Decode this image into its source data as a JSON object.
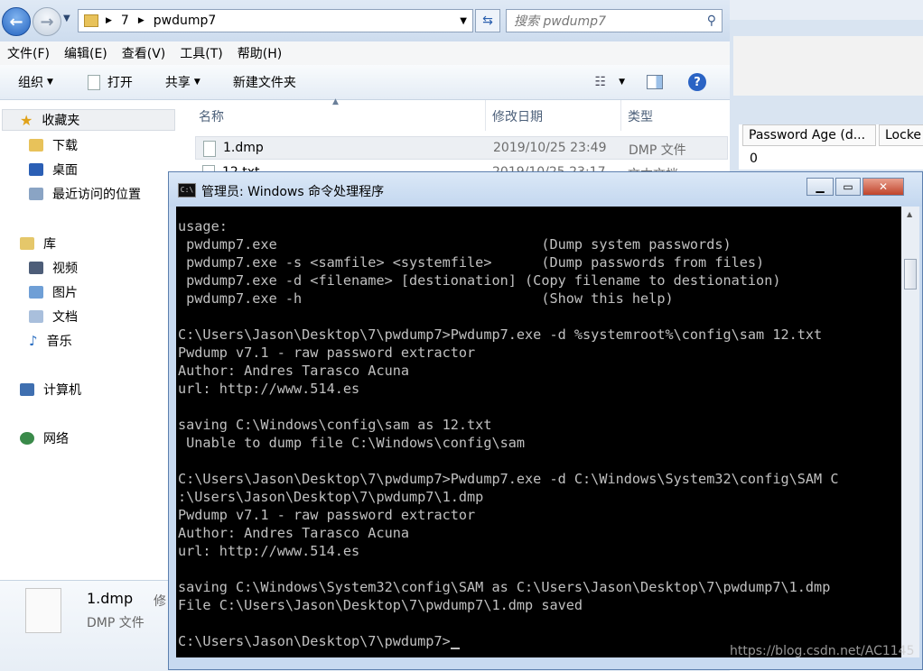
{
  "explorer": {
    "breadcrumb": [
      "7",
      "pwdump7"
    ],
    "search_placeholder": "搜索 pwdump7",
    "menu": [
      "文件(F)",
      "编辑(E)",
      "查看(V)",
      "工具(T)",
      "帮助(H)"
    ],
    "toolbar": {
      "organize": "组织",
      "open": "打开",
      "share": "共享",
      "new_folder": "新建文件夹"
    },
    "nav": {
      "favorites": "收藏夹",
      "downloads": "下载",
      "desktop": "桌面",
      "recent": "最近访问的位置",
      "libraries": "库",
      "videos": "视频",
      "pictures": "图片",
      "documents": "文档",
      "music": "音乐",
      "computer": "计算机",
      "network": "网络"
    },
    "columns": {
      "name": "名称",
      "modified": "修改日期",
      "type": "类型"
    },
    "files": [
      {
        "name": "1.dmp",
        "modified": "2019/10/25 23:49",
        "type": "DMP 文件"
      },
      {
        "name": "12.txt",
        "modified": "2019/10/25 23:17",
        "type": "文本文档"
      }
    ],
    "details": {
      "name": "1.dmp",
      "label_cut": "修",
      "type": "DMP 文件"
    }
  },
  "right_window": {
    "col_password_age": "Password Age (d...",
    "col_locked": "Locke",
    "value": "0"
  },
  "cmd": {
    "title": "管理员: Windows 命令处理程序",
    "lines": [
      "usage:",
      " pwdump7.exe                                (Dump system passwords)",
      " pwdump7.exe -s <samfile> <systemfile>      (Dump passwords from files)",
      " pwdump7.exe -d <filename> [destionation] (Copy filename to destionation)",
      " pwdump7.exe -h                             (Show this help)",
      "",
      "C:\\Users\\Jason\\Desktop\\7\\pwdump7>Pwdump7.exe -d %systemroot%\\config\\sam 12.txt",
      "Pwdump v7.1 - raw password extractor",
      "Author: Andres Tarasco Acuna",
      "url: http://www.514.es",
      "",
      "saving C:\\Windows\\config\\sam as 12.txt",
      " Unable to dump file C:\\Windows\\config\\sam",
      "",
      "C:\\Users\\Jason\\Desktop\\7\\pwdump7>Pwdump7.exe -d C:\\Windows\\System32\\config\\SAM C",
      ":\\Users\\Jason\\Desktop\\7\\pwdump7\\1.dmp",
      "Pwdump v7.1 - raw password extractor",
      "Author: Andres Tarasco Acuna",
      "url: http://www.514.es",
      "",
      "saving C:\\Windows\\System32\\config\\SAM as C:\\Users\\Jason\\Desktop\\7\\pwdump7\\1.dmp",
      "File C:\\Users\\Jason\\Desktop\\7\\pwdump7\\1.dmp saved",
      "",
      "C:\\Users\\Jason\\Desktop\\7\\pwdump7>"
    ]
  },
  "watermark": "https://blog.csdn.net/AC1145"
}
